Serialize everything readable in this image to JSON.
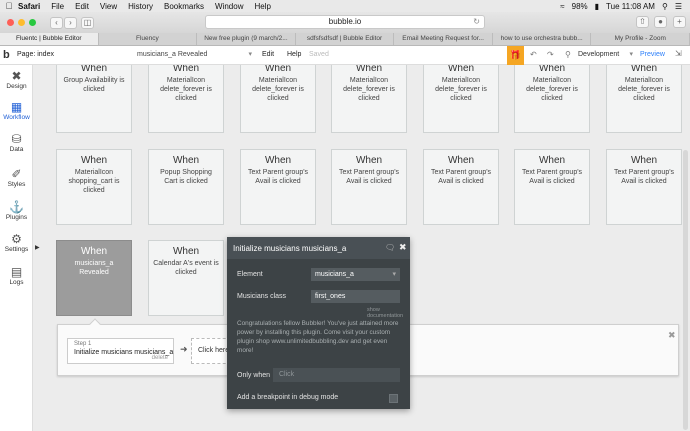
{
  "menubar": {
    "app": "Safari",
    "items": [
      "File",
      "Edit",
      "View",
      "History",
      "Bookmarks",
      "Window",
      "Help"
    ],
    "battery": "98%",
    "clock": "Tue 11:08 AM"
  },
  "browser": {
    "url": "bubble.io",
    "tabs": [
      "Fluentc | Bubble Editor",
      "Fluency",
      "New free plugin (9 march/2...",
      "sdfsfsdfsdf | Bubble Editor",
      "Email Meeting Request for...",
      "how to use orchestra bubb...",
      "My Profile - Zoom"
    ],
    "active_tab": 0
  },
  "editor": {
    "page_label": "Page: index",
    "element_selector": "musicians_a Revealed",
    "edit": "Edit",
    "help": "Help",
    "saved": "Saved",
    "environment": "Development",
    "preview": "Preview"
  },
  "sidebar": {
    "items": [
      {
        "label": "Design",
        "icon": "design-icon"
      },
      {
        "label": "Workflow",
        "icon": "workflow-icon"
      },
      {
        "label": "Data",
        "icon": "data-icon"
      },
      {
        "label": "Styles",
        "icon": "styles-icon"
      },
      {
        "label": "Plugins",
        "icon": "plugins-icon"
      },
      {
        "label": "Settings",
        "icon": "settings-icon"
      },
      {
        "label": "Logs",
        "icon": "logs-icon"
      }
    ],
    "active": "Workflow"
  },
  "events": {
    "row1": [
      {
        "when": "When",
        "event": "Group Availability is clicked"
      },
      {
        "when": "When",
        "event": "MaterialIcon delete_forever is clicked"
      },
      {
        "when": "When",
        "event": "MaterialIcon delete_forever is clicked"
      },
      {
        "when": "When",
        "event": "MaterialIcon delete_forever is clicked"
      },
      {
        "when": "When",
        "event": "MaterialIcon delete_forever is clicked"
      },
      {
        "when": "When",
        "event": "MaterialIcon delete_forever is clicked"
      },
      {
        "when": "When",
        "event": "MaterialIcon delete_forever is clicked"
      }
    ],
    "row2": [
      {
        "when": "When",
        "event": "MaterialIcon shopping_cart is clicked"
      },
      {
        "when": "When",
        "event": "Popup Shopping Cart is clicked"
      },
      {
        "when": "When",
        "event": "Text Parent group's Avail is clicked"
      },
      {
        "when": "When",
        "event": "Text Parent group's Avail is clicked"
      },
      {
        "when": "When",
        "event": "Text Parent group's Avail is clicked"
      },
      {
        "when": "When",
        "event": "Text Parent group's Avail is clicked"
      },
      {
        "when": "When",
        "event": "Text Parent group's Avail is clicked"
      }
    ],
    "row3": [
      {
        "when": "When",
        "event": "musicians_a Revealed"
      },
      {
        "when": "When",
        "event": "Calendar A's event is clicked"
      }
    ]
  },
  "workflow": {
    "step_number": "Step 1",
    "step_name": "Initialize musicians musicians_a",
    "delete": "delete",
    "add_step": "Click here"
  },
  "panel": {
    "title": "Initialize musicians musicians_a",
    "element_label": "Element",
    "element_value": "musicians_a",
    "class_label": "Musicians class",
    "class_value": "first_ones",
    "show_documentation": "show documentation",
    "promo": "Congratulations fellow Bubbler! You've just attained more power by installing this plugin. Come visit your custom plugin shop www.unlimitedbubbling.dev and get even more!",
    "only_when_label": "Only when",
    "only_when_placeholder": "Click",
    "breakpoint_label": "Add a breakpoint in debug mode"
  },
  "colors": {
    "accent_blue": "#1f5fd6",
    "gift_orange": "#f5a623",
    "panel_bg": "#3d4346"
  }
}
